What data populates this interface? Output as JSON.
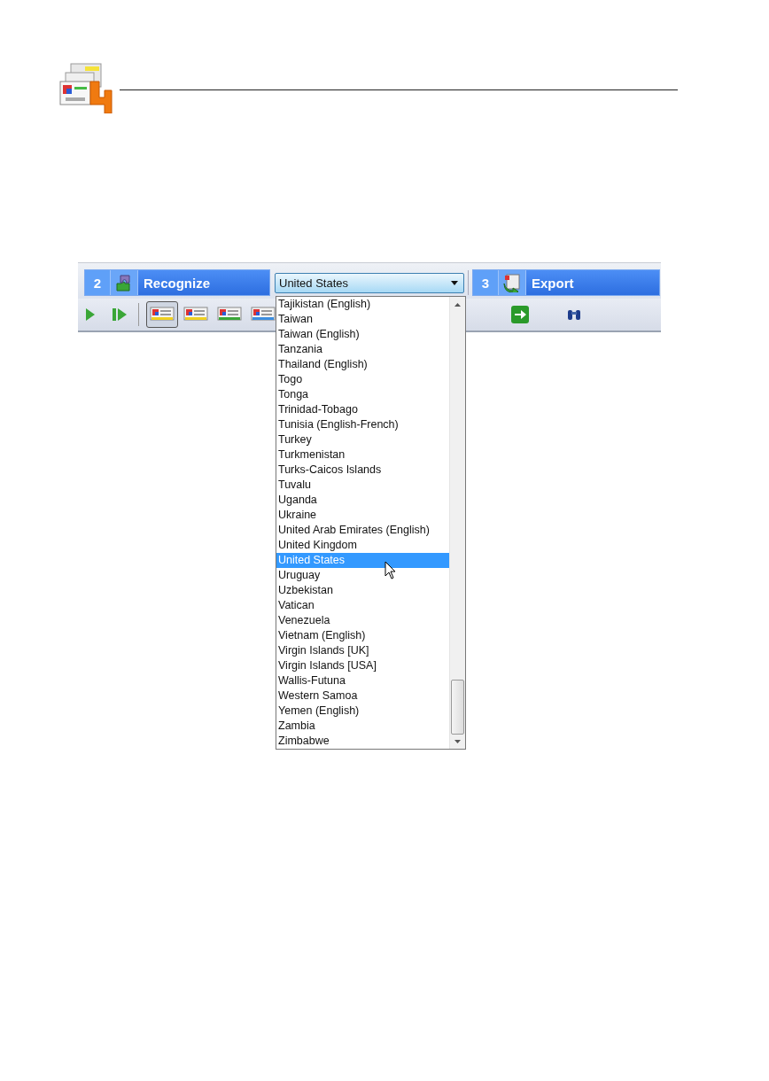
{
  "steps": [
    {
      "number": "2",
      "label": "Recognize",
      "kind": "recognize"
    },
    {
      "number": "3",
      "label": "Export",
      "kind": "export"
    }
  ],
  "combo": {
    "value": "United States"
  },
  "view_buttons": [
    {
      "selected": true
    },
    {
      "selected": false
    },
    {
      "selected": false
    },
    {
      "selected": false
    }
  ],
  "dropdown": {
    "items": [
      {
        "label": "Tajikistan (English)",
        "selected": false
      },
      {
        "label": "Taiwan",
        "selected": false
      },
      {
        "label": "Taiwan (English)",
        "selected": false
      },
      {
        "label": "Tanzania",
        "selected": false
      },
      {
        "label": "Thailand (English)",
        "selected": false
      },
      {
        "label": "Togo",
        "selected": false
      },
      {
        "label": "Tonga",
        "selected": false
      },
      {
        "label": "Trinidad-Tobago",
        "selected": false
      },
      {
        "label": "Tunisia (English-French)",
        "selected": false
      },
      {
        "label": "Turkey",
        "selected": false
      },
      {
        "label": "Turkmenistan",
        "selected": false
      },
      {
        "label": "Turks-Caicos Islands",
        "selected": false
      },
      {
        "label": "Tuvalu",
        "selected": false
      },
      {
        "label": "Uganda",
        "selected": false
      },
      {
        "label": "Ukraine",
        "selected": false
      },
      {
        "label": "United Arab Emirates (English)",
        "selected": false
      },
      {
        "label": "United Kingdom",
        "selected": false
      },
      {
        "label": "United States",
        "selected": true
      },
      {
        "label": "Uruguay",
        "selected": false
      },
      {
        "label": "Uzbekistan",
        "selected": false
      },
      {
        "label": "Vatican",
        "selected": false
      },
      {
        "label": "Venezuela",
        "selected": false
      },
      {
        "label": "Vietnam (English)",
        "selected": false
      },
      {
        "label": "Virgin Islands [UK]",
        "selected": false
      },
      {
        "label": "Virgin Islands [USA]",
        "selected": false
      },
      {
        "label": "Wallis-Futuna",
        "selected": false
      },
      {
        "label": "Western Samoa",
        "selected": false
      },
      {
        "label": "Yemen (English)",
        "selected": false
      },
      {
        "label": "Zambia",
        "selected": false
      },
      {
        "label": "Zimbabwe",
        "selected": false
      }
    ]
  }
}
